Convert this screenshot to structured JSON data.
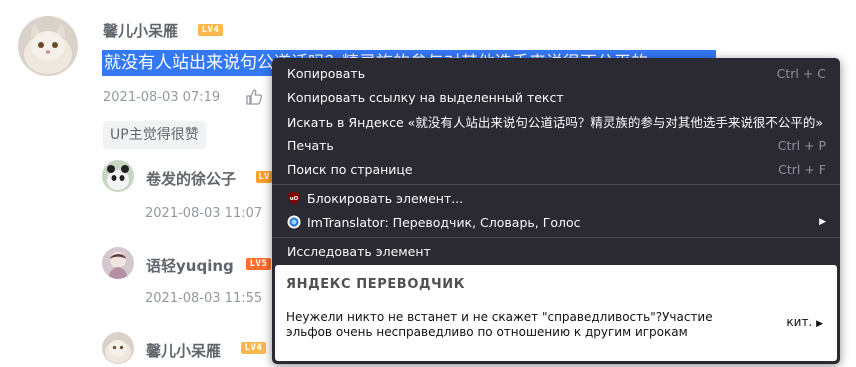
{
  "comment": {
    "username": "馨儿小呆雁",
    "level": "LV4",
    "text": "就没有人站出来说句公道话吗？精灵族的参与对其他选手来说很不公平的",
    "date": "2021-08-03 07:19",
    "tag": "UP主觉得很赞"
  },
  "replies": [
    {
      "username": "卷发的徐公子",
      "level": "LV",
      "date": "2021-08-03 11:07"
    },
    {
      "username": "语轻yuqing",
      "level": "LV5",
      "date": "2021-08-03 11:55"
    },
    {
      "username": "馨儿小呆雁",
      "level": "LV4"
    }
  ],
  "context_menu": {
    "items": [
      {
        "label": "Копировать",
        "shortcut": "Ctrl + C"
      },
      {
        "label": "Копировать ссылку на выделенный текст",
        "shortcut": ""
      },
      {
        "label": "Искать в Яндексе «就没有人站出来说句公道话吗？精灵族的参与对其他选手来说很不公平的»",
        "shortcut": ""
      },
      {
        "label": "Печать",
        "shortcut": "Ctrl + P"
      },
      {
        "label": "Поиск по странице",
        "shortcut": "Ctrl + F"
      }
    ],
    "extensions": [
      {
        "label": "Блокировать элемент...",
        "icon": "ublock-icon"
      },
      {
        "label": "ImTranslator: Переводчик, Словарь, Голос",
        "icon": "imtranslator-icon",
        "has_submenu": true
      }
    ],
    "inspect": "Исследовать элемент",
    "translator": {
      "title": "ЯНДЕКС ПЕРЕВОДЧИК",
      "text": "Неужели никто не встанет и не скажет \"справедливость\"?Участие эльфов очень несправедливо по отношению к другим игрокам",
      "lang": "кит.",
      "arrow": "▶"
    }
  },
  "colors": {
    "selection": "#3478f6",
    "menu_bg": "#2b2a33",
    "level_badge": "#ff9f27"
  }
}
